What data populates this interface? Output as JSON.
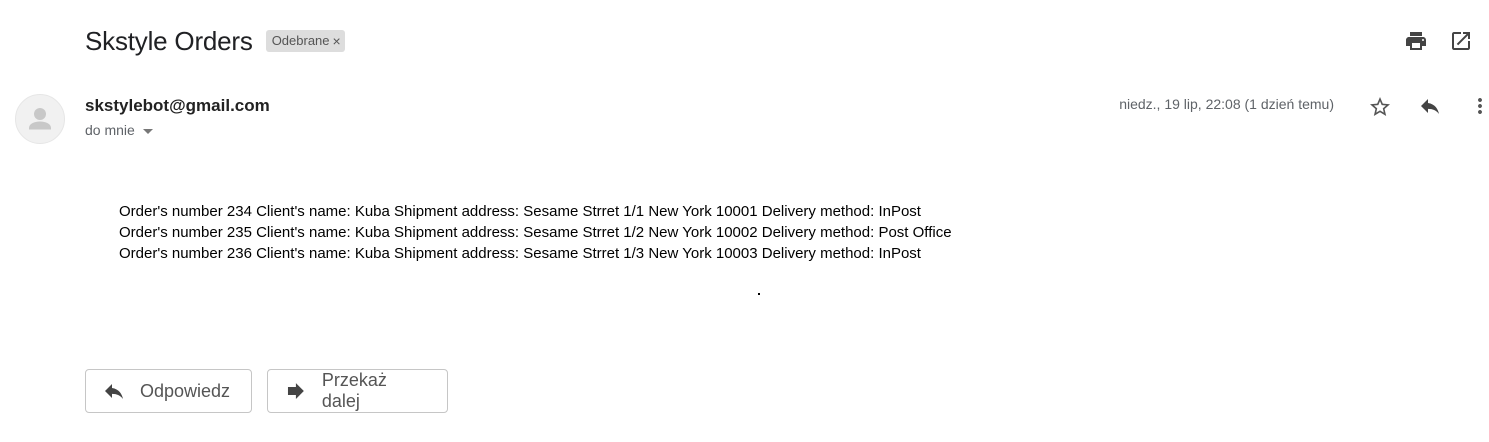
{
  "email": {
    "subject": "Skstyle Orders",
    "label": "Odebrane",
    "label_remove": "×",
    "sender": "skstylebot@gmail.com",
    "recipient": "do mnie",
    "date": "niedz., 19 lip, 22:08 (1 dzień temu)",
    "body_lines": [
      "Order's number 234 Client's name: Kuba Shipment address: Sesame Strret 1/1 New York 10001 Delivery method: InPost",
      "Order's number 235 Client's name: Kuba Shipment address: Sesame Strret 1/2 New York 10002 Delivery method: Post Office",
      "Order's number 236 Client's name: Kuba Shipment address: Sesame Strret 1/3 New York 10003 Delivery method: InPost"
    ]
  },
  "actions": {
    "reply_label": "Odpowiedz",
    "forward_label": "Przekaż dalej"
  },
  "icons": {
    "print": "print-icon",
    "open_new_window": "open-in-new-window-icon",
    "star": "star-icon",
    "reply": "reply-icon",
    "more": "more-vertical-icon",
    "forward": "forward-icon",
    "avatar": "default-avatar-icon"
  },
  "colors": {
    "text": "#222222",
    "muted": "#5f6368",
    "icon": "#444444",
    "chip_bg": "#dddddd",
    "border": "#c6c6c6"
  }
}
